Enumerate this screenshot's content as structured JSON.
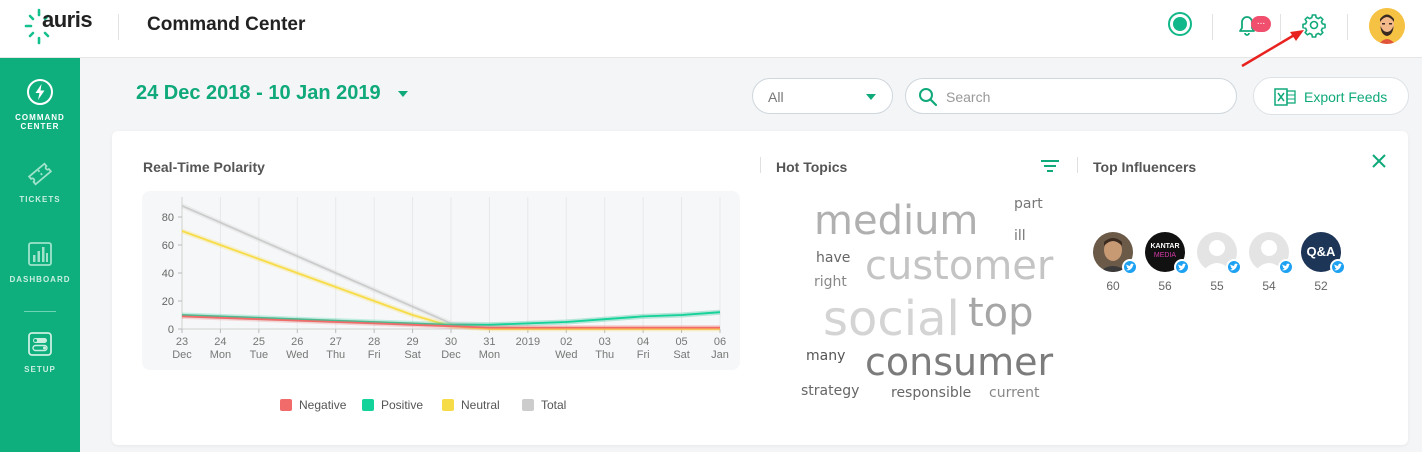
{
  "app": {
    "logo_text": "auris",
    "title": "Command Center",
    "notification_badge": "..."
  },
  "sidebar": {
    "items": [
      {
        "id": "command-center",
        "label_line1": "COMMAND",
        "label_line2": "CENTER",
        "active": true
      },
      {
        "id": "tickets",
        "label_line1": "TICKETS",
        "label_line2": ""
      },
      {
        "id": "dashboard",
        "label_line1": "DASHBOARD",
        "label_line2": ""
      },
      {
        "id": "setup",
        "label_line1": "SETUP",
        "label_line2": ""
      }
    ]
  },
  "filters": {
    "date_range": "24 Dec 2018 - 10 Jan 2019",
    "channel_select": "All",
    "search_placeholder": "Search",
    "export_label": "Export Feeds"
  },
  "polarity": {
    "title": "Real-Time Polarity"
  },
  "chart_data": {
    "type": "line",
    "title": "Real-Time Polarity",
    "x": [
      "23 Dec",
      "24 Mon",
      "25 Tue",
      "26 Wed",
      "27 Thu",
      "28 Fri",
      "29 Sat",
      "30 Dec",
      "31 Mon",
      "2019",
      "02 Wed",
      "03 Thu",
      "04 Fri",
      "05 Sat",
      "06 Jan"
    ],
    "x_tick_top": [
      "23",
      "24",
      "25",
      "26",
      "27",
      "28",
      "29",
      "30",
      "31",
      "2019",
      "02",
      "03",
      "04",
      "05",
      "06"
    ],
    "x_tick_bottom": [
      "Dec",
      "Mon",
      "Tue",
      "Wed",
      "Thu",
      "Fri",
      "Sat",
      "Dec",
      "Mon",
      "",
      "Wed",
      "Thu",
      "Fri",
      "Sat",
      "Jan"
    ],
    "y_ticks": [
      0,
      20,
      40,
      60,
      80
    ],
    "ylim": [
      0,
      90
    ],
    "grid": true,
    "series": [
      {
        "name": "Negative",
        "color": "#f26b6b",
        "values": [
          9,
          8,
          7,
          6,
          5,
          4,
          3,
          2,
          1,
          1,
          1,
          1,
          1,
          1,
          1
        ]
      },
      {
        "name": "Positive",
        "color": "#14d39a",
        "values": [
          10,
          9,
          8,
          7,
          6,
          5,
          4,
          3,
          3,
          4,
          5,
          7,
          9,
          10,
          12
        ]
      },
      {
        "name": "Neutral",
        "color": "#f7dc4a",
        "values": [
          70,
          60,
          50,
          40,
          30,
          20,
          10,
          2,
          0,
          0,
          0,
          0,
          0,
          0,
          0
        ]
      },
      {
        "name": "Total",
        "color": "#cccccc",
        "values": [
          88,
          76,
          64,
          52,
          40,
          28,
          16,
          4,
          3,
          4,
          5,
          7,
          9,
          10,
          12
        ]
      }
    ],
    "legend_position": "bottom"
  },
  "hot_topics": {
    "title": "Hot Topics",
    "words": [
      {
        "text": "medium",
        "size": 40,
        "color": "#b0b0b0"
      },
      {
        "text": "part",
        "size": 14,
        "color": "#777777"
      },
      {
        "text": "ill",
        "size": 14,
        "color": "#777777"
      },
      {
        "text": "have",
        "size": 14,
        "color": "#666666"
      },
      {
        "text": "customer",
        "size": 40,
        "color": "#c4c4c4"
      },
      {
        "text": "right",
        "size": 14,
        "color": "#888888"
      },
      {
        "text": "social",
        "size": 48,
        "color": "#d4d4d4"
      },
      {
        "text": "top",
        "size": 40,
        "color": "#a6a6a6"
      },
      {
        "text": "many",
        "size": 14,
        "color": "#555555"
      },
      {
        "text": "consumer",
        "size": 38,
        "color": "#7c7c7c"
      },
      {
        "text": "strategy",
        "size": 14,
        "color": "#666666"
      },
      {
        "text": "responsible",
        "size": 14,
        "color": "#666666"
      },
      {
        "text": "current",
        "size": 14,
        "color": "#888888"
      }
    ]
  },
  "influencers": {
    "title": "Top Influencers",
    "items": [
      {
        "kind": "photo-man",
        "count": "60"
      },
      {
        "kind": "kantar-logo",
        "logo_line1": "KANTAR",
        "logo_line2": "MEDIA",
        "count": "56"
      },
      {
        "kind": "placeholder",
        "count": "55"
      },
      {
        "kind": "placeholder",
        "count": "54"
      },
      {
        "kind": "qa-logo",
        "logo_text": "Q&A",
        "count": "52"
      }
    ]
  },
  "colors": {
    "brand": "#0fae7d",
    "accent": "#10a97a",
    "badge": "#f0506e",
    "twitter": "#1da1f2"
  },
  "icons": [
    "logo-icon",
    "status-online-icon",
    "bell-icon",
    "gear-icon",
    "user-avatar",
    "lightning-icon",
    "ticket-icon",
    "bar-chart-icon",
    "toggle-settings-icon",
    "search-icon",
    "excel-icon",
    "filter-lines-icon",
    "close-icon",
    "twitter-icon"
  ]
}
